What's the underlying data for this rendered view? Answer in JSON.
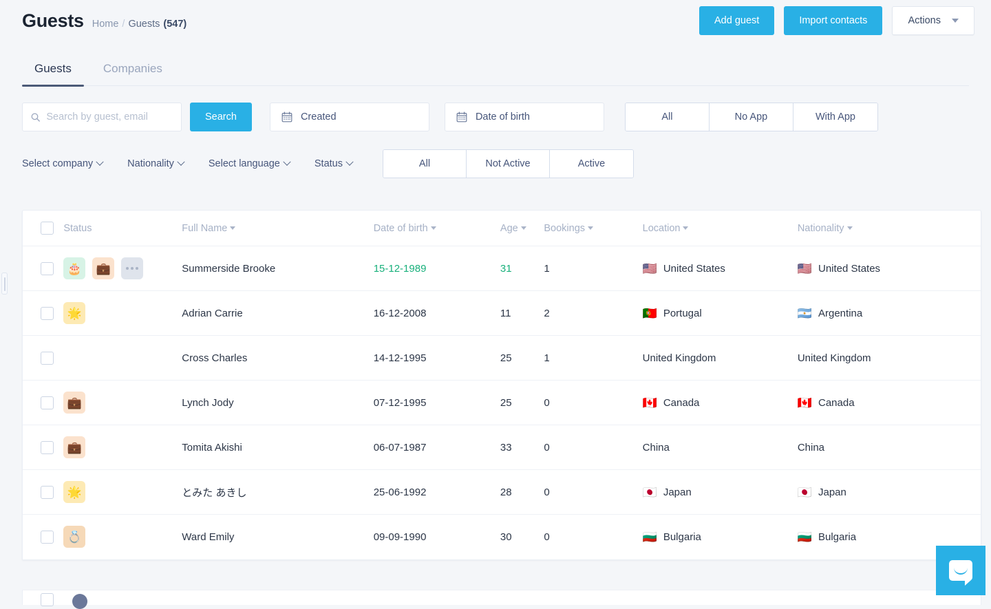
{
  "header": {
    "title": "Guests",
    "breadcrumb": {
      "home": "Home",
      "separator": "/",
      "current": "Guests",
      "count": "(547)"
    },
    "buttons": {
      "add_guest": "Add guest",
      "import_contacts": "Import contacts",
      "actions": "Actions"
    },
    "accent_color": "#29b0e5"
  },
  "tabs": [
    {
      "label": "Guests",
      "active": true
    },
    {
      "label": "Companies",
      "active": false
    }
  ],
  "filters": {
    "search": {
      "placeholder": "Search by guest, email",
      "value": "",
      "button": "Search"
    },
    "created": {
      "label": "Created"
    },
    "date_of_birth": {
      "label": "Date of birth"
    },
    "app_group": [
      {
        "label": "All",
        "selected": false
      },
      {
        "label": "No App",
        "selected": false
      },
      {
        "label": "With App",
        "selected": false
      }
    ],
    "dropdowns": [
      {
        "label": "Select company"
      },
      {
        "label": "Nationality"
      },
      {
        "label": "Select language"
      },
      {
        "label": "Status"
      }
    ],
    "active_group": [
      {
        "label": "All",
        "selected": false
      },
      {
        "label": "Not Active",
        "selected": false
      },
      {
        "label": "Active",
        "selected": false
      }
    ]
  },
  "table": {
    "columns": [
      {
        "key": "status",
        "label": "Status",
        "sortable": false
      },
      {
        "key": "full_name",
        "label": "Full Name",
        "sortable": true
      },
      {
        "key": "dob",
        "label": "Date of birth",
        "sortable": true
      },
      {
        "key": "age",
        "label": "Age",
        "sortable": true
      },
      {
        "key": "bookings",
        "label": "Bookings",
        "sortable": true
      },
      {
        "key": "location",
        "label": "Location",
        "sortable": true
      },
      {
        "key": "nationality",
        "label": "Nationality",
        "sortable": true
      }
    ],
    "rows": [
      {
        "status_icons": [
          "birthday-cake-icon",
          "briefcase-icon",
          "more-dots-icon"
        ],
        "full_name": "Summerside Brooke",
        "dob": "15-12-1989",
        "dob_highlight": true,
        "age": "31",
        "age_highlight": true,
        "bookings": "1",
        "location": "United States",
        "location_flag": "🇺🇸",
        "nationality": "United States",
        "nationality_flag": "🇺🇸"
      },
      {
        "status_icons": [
          "vip-star-icon"
        ],
        "full_name": "Adrian Carrie",
        "dob": "16-12-2008",
        "dob_highlight": false,
        "age": "11",
        "age_highlight": false,
        "bookings": "2",
        "location": "Portugal",
        "location_flag": "🇵🇹",
        "nationality": "Argentina",
        "nationality_flag": "🇦🇷"
      },
      {
        "status_icons": [],
        "full_name": "Cross Charles",
        "dob": "14-12-1995",
        "dob_highlight": false,
        "age": "25",
        "age_highlight": false,
        "bookings": "1",
        "location": "United Kingdom",
        "location_flag": "",
        "nationality": "United Kingdom",
        "nationality_flag": ""
      },
      {
        "status_icons": [
          "briefcase-icon"
        ],
        "full_name": "Lynch Jody",
        "dob": "07-12-1995",
        "dob_highlight": false,
        "age": "25",
        "age_highlight": false,
        "bookings": "0",
        "location": "Canada",
        "location_flag": "🇨🇦",
        "nationality": "Canada",
        "nationality_flag": "🇨🇦"
      },
      {
        "status_icons": [
          "briefcase-icon"
        ],
        "full_name": "Tomita Akishi",
        "dob": "06-07-1987",
        "dob_highlight": false,
        "age": "33",
        "age_highlight": false,
        "bookings": "0",
        "location": "China",
        "location_flag": "",
        "nationality": "China",
        "nationality_flag": ""
      },
      {
        "status_icons": [
          "vip-star-icon"
        ],
        "full_name": "とみた あきし",
        "dob": "25-06-1992",
        "dob_highlight": false,
        "age": "28",
        "age_highlight": false,
        "bookings": "0",
        "location": "Japan",
        "location_flag": "🇯🇵",
        "nationality": "Japan",
        "nationality_flag": "🇯🇵"
      },
      {
        "status_icons": [
          "honeymoon-ring-icon"
        ],
        "full_name": "Ward Emily",
        "dob": "09-09-1990",
        "dob_highlight": false,
        "age": "30",
        "age_highlight": false,
        "bookings": "0",
        "location": "Bulgaria",
        "location_flag": "🇧🇬",
        "nationality": "Bulgaria",
        "nationality_flag": "🇧🇬"
      }
    ]
  },
  "widgets": {
    "intercom_launcher": "chat-bubble-icon"
  }
}
